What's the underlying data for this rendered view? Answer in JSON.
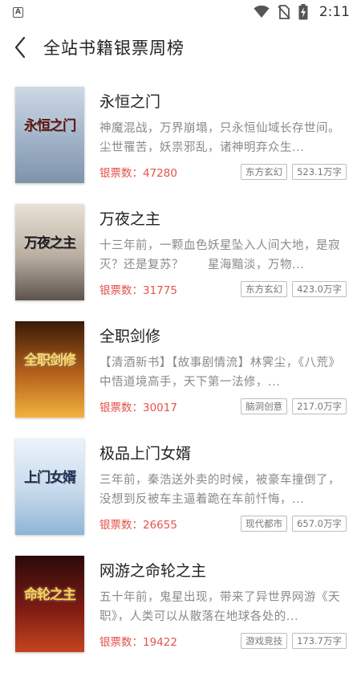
{
  "status_bar": {
    "app_badge": "A",
    "time": "2:11"
  },
  "header": {
    "title": "全站书籍银票周榜"
  },
  "books": [
    {
      "title": "永恒之门",
      "desc": "神魔混战，万界崩塌，只永恒仙域长存世间。尘世罹苦，妖祟邪乱，诸神明弃众生...",
      "votes": "银票数：47280",
      "category": "东方玄幻",
      "words": "523.1万字",
      "cover_text": "永恒之门",
      "cover_colors": [
        "#cfd9e6",
        "#9fb2c8",
        "#7f93aa"
      ],
      "cover_text_color": "#5a1414"
    },
    {
      "title": "万夜之主",
      "desc": "十三年前，一颗血色妖星坠入人间大地，是寂灭？还是复苏？　　星海黯淡，万物...",
      "votes": "银票数：31775",
      "category": "东方玄幻",
      "words": "423.0万字",
      "cover_text": "万夜之主",
      "cover_colors": [
        "#e8e2d6",
        "#b9ada0",
        "#5b534d"
      ],
      "cover_text_color": "#1e1a1a"
    },
    {
      "title": "全职剑修",
      "desc": "【清酒新书】【故事剧情流】林霁尘，《八荒》中悟道境高手，天下第一法修，...",
      "votes": "银票数：30017",
      "category": "脑洞创意",
      "words": "217.0万字",
      "cover_text": "全职剑修",
      "cover_colors": [
        "#3a1a06",
        "#b5621b",
        "#f2b33d"
      ],
      "cover_text_color": "#ffd861"
    },
    {
      "title": "极品上门女婿",
      "desc": "三年前，秦浩送外卖的时候，被豪车撞倒了，没想到反被车主逼着跪在车前忏悔，...",
      "votes": "银票数：26655",
      "category": "现代都市",
      "words": "657.0万字",
      "cover_text": "上门女婿",
      "cover_colors": [
        "#ecf3fa",
        "#c6d9ec",
        "#8fb4d6"
      ],
      "cover_text_color": "#1c2f55"
    },
    {
      "title": "网游之命轮之主",
      "desc": "五十年前，鬼星出现，带来了异世界网游《天职》，人类可以从散落在地球各处的...",
      "votes": "银票数：19422",
      "category": "游戏竞技",
      "words": "173.7万字",
      "cover_text": "命轮之主",
      "cover_colors": [
        "#2a0a0a",
        "#7d1c14",
        "#c54420"
      ],
      "cover_text_color": "#ffd24a"
    }
  ]
}
